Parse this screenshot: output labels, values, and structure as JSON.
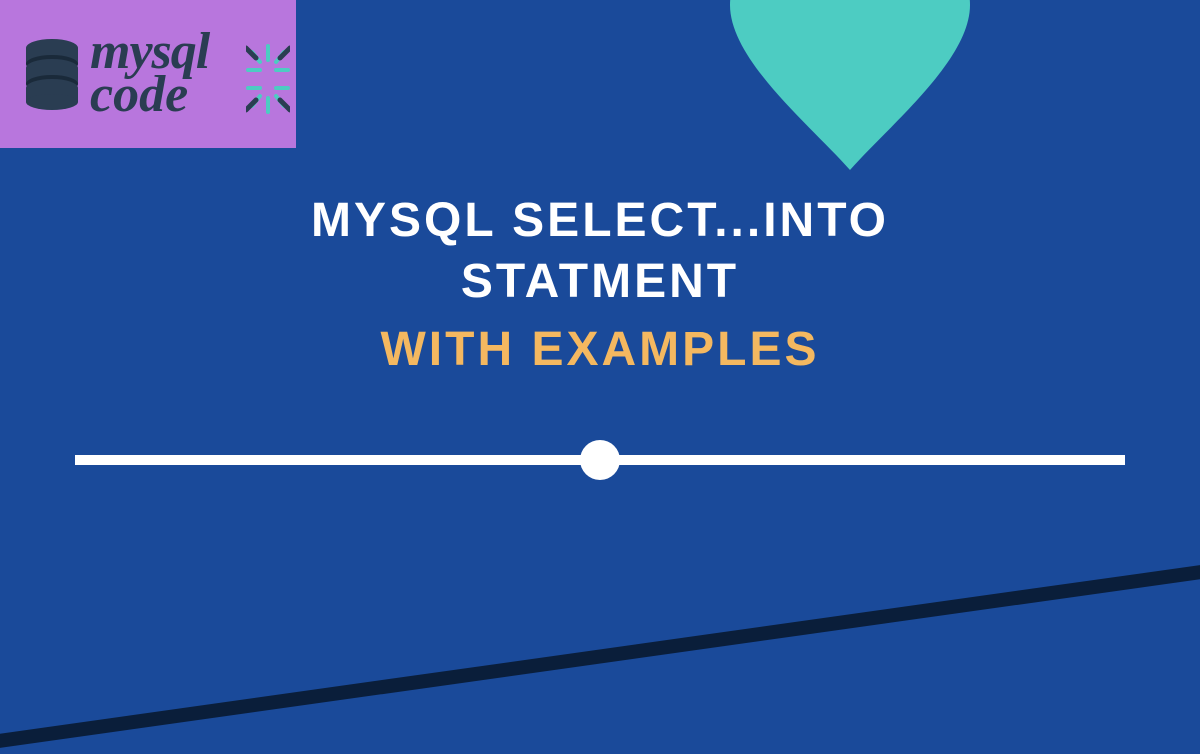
{
  "logo": {
    "line1": "mysql",
    "line2": "code"
  },
  "title": {
    "line1": "MYSQL SELECT...INTO",
    "line2": "STATMENT",
    "subtitle": "WITH EXAMPLES"
  },
  "colors": {
    "bg": "#1a4a9a",
    "frame": "#0a1e3a",
    "logo_bg": "#b876dd",
    "accent_teal": "#4dccc2",
    "text_white": "#ffffff",
    "text_orange": "#f4b860",
    "logo_text": "#2a3d52"
  }
}
